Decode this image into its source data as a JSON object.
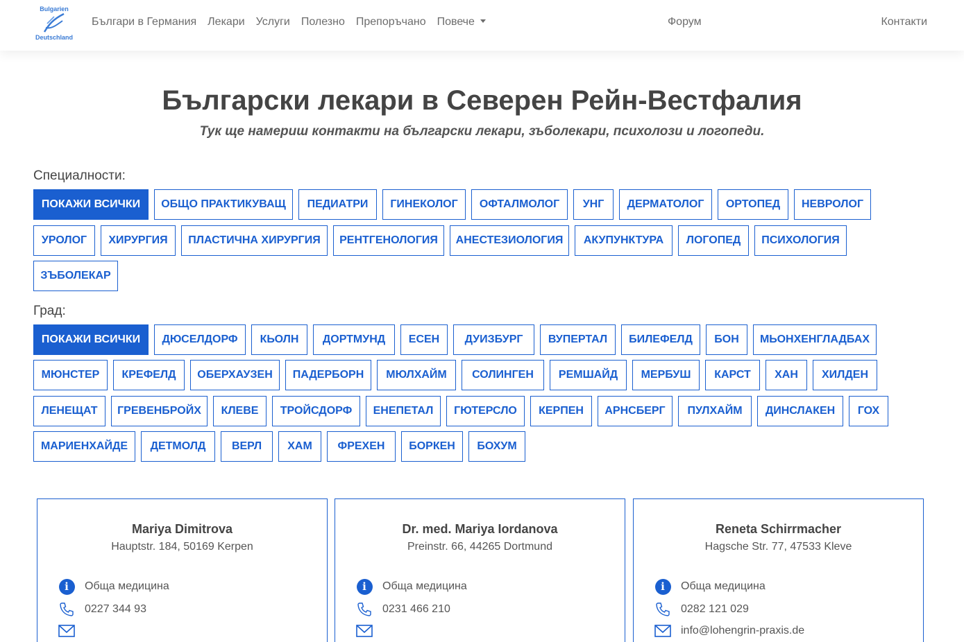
{
  "nav": {
    "logo_text_top": "Bulgarien",
    "logo_text_bottom": "Deutschland",
    "links": [
      "Българи в Германия",
      "Лекари",
      "Услуги",
      "Полезно",
      "Препоръчано",
      "Повече"
    ],
    "forum": "Форум",
    "contacts": "Контакти"
  },
  "header": {
    "title": "Български лекари в Северен Рейн-Вестфалия",
    "subtitle": "Тук ще намериш контакти на български лекари, зъболекари, психолози и логопеди."
  },
  "specialties": {
    "label": "Специалности:",
    "items": [
      "ПОКАЖИ ВСИЧКИ",
      "ОБЩО ПРАКТИКУВАЩ",
      "ПЕДИАТРИ",
      "ГИНЕКОЛОГ",
      "ОФТАЛМОЛОГ",
      "УНГ",
      "ДЕРМАТОЛОГ",
      "ОРТОПЕД",
      "НЕВРОЛОГ",
      "УРОЛОГ",
      "ХИРУРГИЯ",
      "ПЛАСТИЧНА ХИРУРГИЯ",
      "РЕНТГЕНОЛОГИЯ",
      "АНЕСТЕЗИОЛОГИЯ",
      "АКУПУНКТУРА",
      "ЛОГОПЕД",
      "ПСИХОЛОГИЯ",
      "ЗЪБОЛЕКАР"
    ],
    "active_index": 0
  },
  "cities": {
    "label": "Град:",
    "items": [
      "ПОКАЖИ ВСИЧКИ",
      "ДЮСЕЛДОРФ",
      "КЬОЛН",
      "ДОРТМУНД",
      "ЕСЕН",
      "ДУИЗБУРГ",
      "ВУПЕРТАЛ",
      "БИЛЕФЕЛД",
      "БОН",
      "МЬОНХЕНГЛАДБАХ",
      "МЮНСТЕР",
      "КРЕФЕЛД",
      "ОБЕРХАУЗЕН",
      "ПАДЕРБОРН",
      "МЮЛХАЙМ",
      "СОЛИНГЕН",
      "РЕМШАЙД",
      "МЕРБУШ",
      "КАРСТ",
      "ХАН",
      "ХИЛДЕН",
      "ЛЕНЕЩАТ",
      "ГРЕВЕНБРОЙХ",
      "КЛЕВЕ",
      "ТРОЙСДОРФ",
      "ЕНЕПЕТАЛ",
      "ГЮТЕРСЛО",
      "КЕРПЕН",
      "АРНСБЕРГ",
      "ПУЛХАЙМ",
      "ДИНСЛАКЕН",
      "ГОХ",
      "МАРИЕНХАЙДЕ",
      "ДЕТМОЛД",
      "ВЕРЛ",
      "ХАМ",
      "ФРЕХЕН",
      "БОРКЕН",
      "БОХУМ"
    ],
    "active_index": 0
  },
  "doctors": [
    {
      "name": "Mariya Dimitrova",
      "address": "Hauptstr. 184, 50169 Kerpen",
      "specialty": "Обща медицина",
      "phone": "0227 344 93",
      "email": ""
    },
    {
      "name": "Dr. med. Mariya Iordanova",
      "address": "Preinstr. 66, 44265 Dortmund",
      "specialty": "Обща медицина",
      "phone": "0231 466 210",
      "email": ""
    },
    {
      "name": "Reneta Schirrmacher",
      "address": "Hagsche Str. 77, 47533 Kleve",
      "specialty": "Обща медицина",
      "phone": "0282 121 029",
      "email": "info@lohengrin-praxis.de"
    }
  ],
  "colors": {
    "accent": "#1a5fd0",
    "nav_text": "#6c6c6c",
    "title": "#444444"
  },
  "icons": {
    "info": "info-icon",
    "phone": "phone-icon",
    "email": "envelope-icon"
  }
}
